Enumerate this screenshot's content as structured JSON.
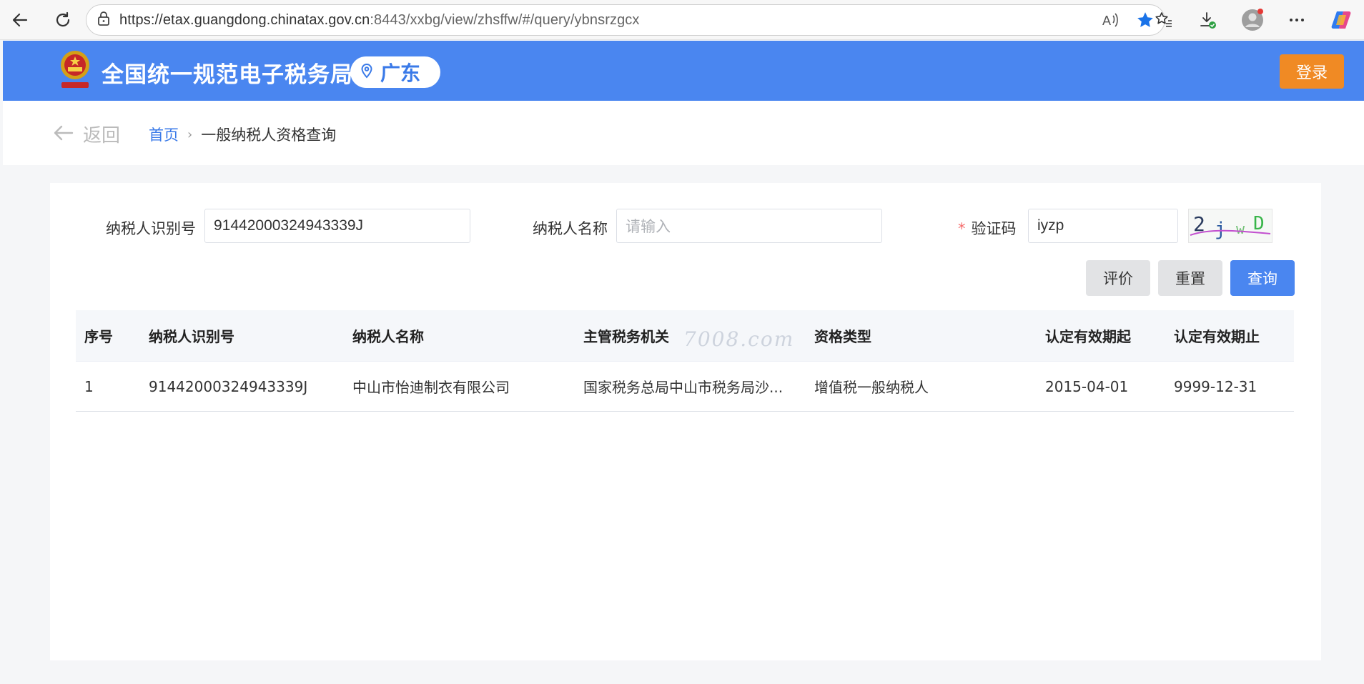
{
  "browser": {
    "url_host": "https://etax.guangdong.chinatax.gov.cn",
    "url_path": ":8443/xxbg/view/zhsffw/#/query/ybnsrzgcx"
  },
  "header": {
    "site_title": "全国统一规范电子税务局",
    "region": "广东",
    "login_label": "登录",
    "brand_color": "#4a86f0",
    "login_color": "#f08a24"
  },
  "breadcrumb": {
    "back_label": "返回",
    "home": "首页",
    "current": "一般纳税人资格查询"
  },
  "form": {
    "taxpayer_id_label": "纳税人识别号",
    "taxpayer_id_value": "91442000324943339J",
    "taxpayer_name_label": "纳税人名称",
    "taxpayer_name_placeholder": "请输入",
    "captcha_required_mark": "*",
    "captcha_label": "验证码",
    "captcha_value": "iyzp",
    "captcha_image_text": "2jwD"
  },
  "buttons": {
    "evaluate": "评价",
    "reset": "重置",
    "query": "查询"
  },
  "table": {
    "columns": [
      "序号",
      "纳税人识别号",
      "纳税人名称",
      "主管税务机关",
      "资格类型",
      "认定有效期起",
      "认定有效期止"
    ],
    "rows": [
      [
        "1",
        "91442000324943339J",
        "中山市怡迪制衣有限公司",
        "国家税务总局中山市税务局沙...",
        "增值税一般纳税人",
        "2015-04-01",
        "9999-12-31"
      ]
    ],
    "watermark": "7008.com"
  }
}
